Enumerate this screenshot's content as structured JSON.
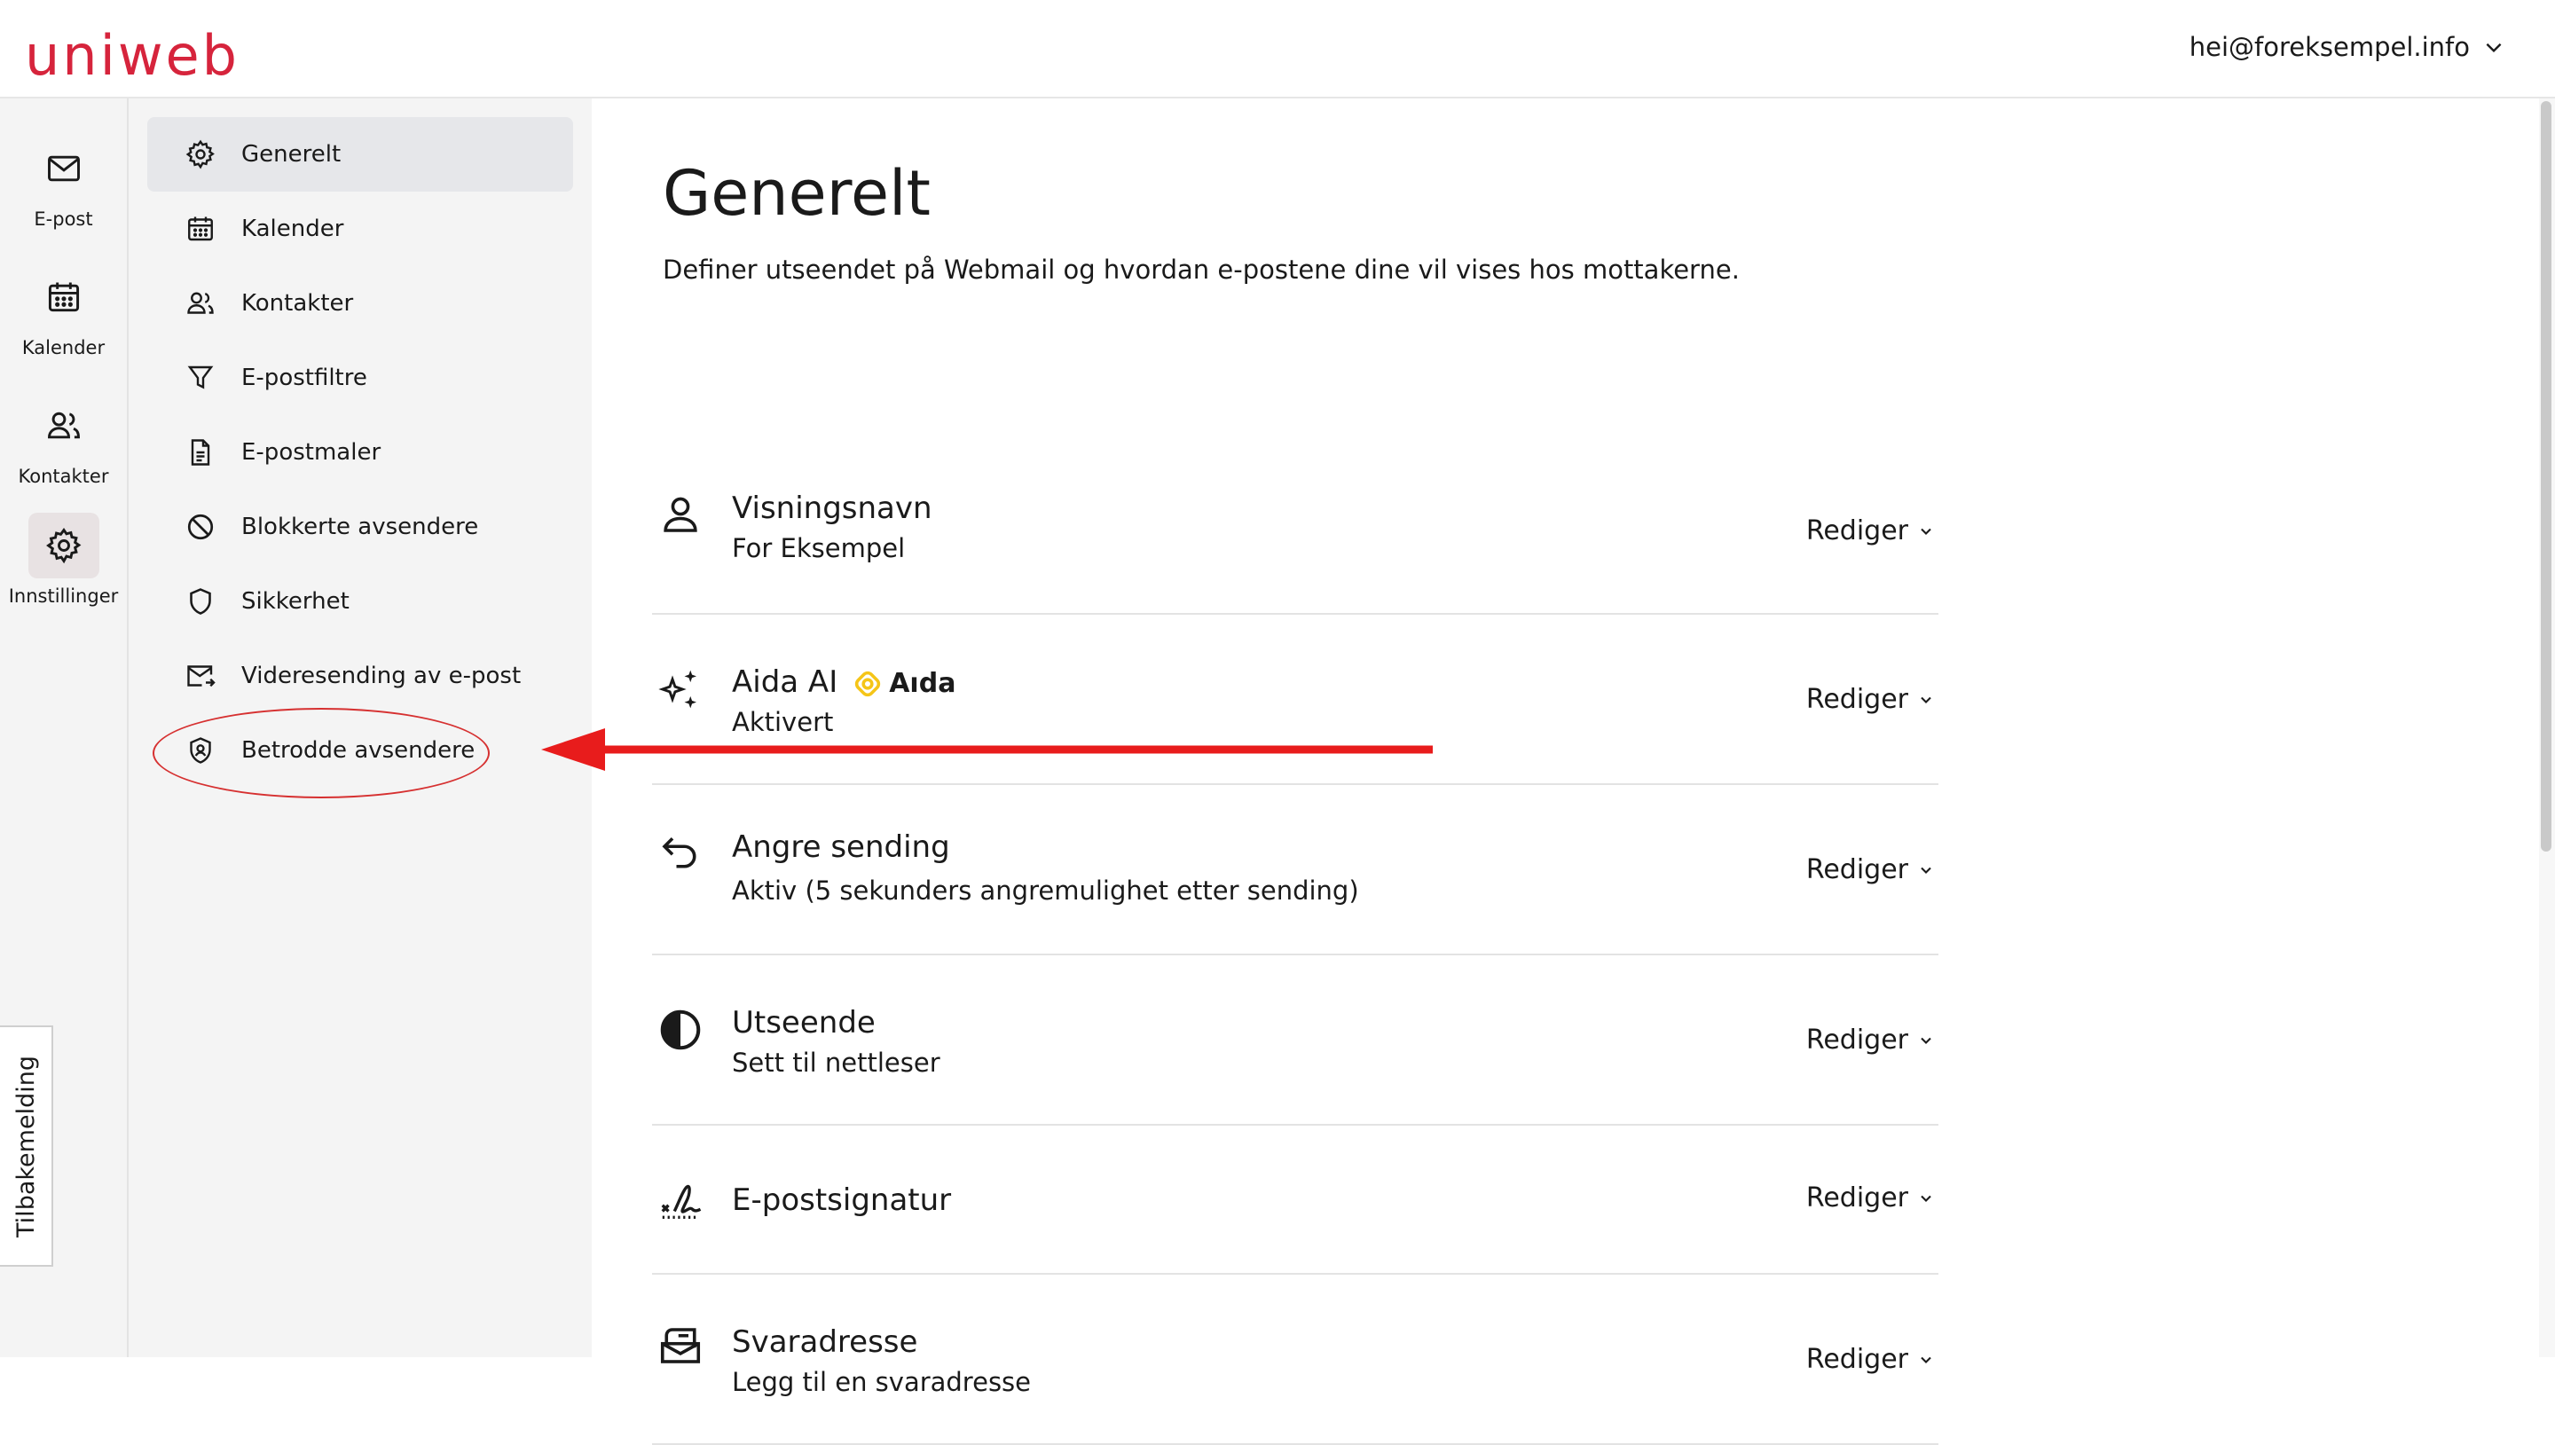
{
  "header": {
    "logo_text": "uniweb",
    "account_email": "hei@foreksempel.info"
  },
  "rail": {
    "items": [
      {
        "label": "E-post",
        "icon": "mail-icon"
      },
      {
        "label": "Kalender",
        "icon": "calendar-icon"
      },
      {
        "label": "Kontakter",
        "icon": "contacts-icon"
      },
      {
        "label": "Innstillinger",
        "icon": "gear-icon",
        "active": true
      }
    ],
    "feedback_label": "Tilbakemelding"
  },
  "submenu": {
    "items": [
      {
        "label": "Generelt",
        "icon": "gear-icon",
        "active": true
      },
      {
        "label": "Kalender",
        "icon": "calendar-icon"
      },
      {
        "label": "Kontakter",
        "icon": "contacts-icon"
      },
      {
        "label": "E-postfiltre",
        "icon": "filter-icon"
      },
      {
        "label": "E-postmaler",
        "icon": "document-icon"
      },
      {
        "label": "Blokkerte avsendere",
        "icon": "block-icon"
      },
      {
        "label": "Sikkerhet",
        "icon": "shield-icon"
      },
      {
        "label": "Videresending av e-post",
        "icon": "forward-mail-icon"
      },
      {
        "label": "Betrodde avsendere",
        "icon": "trusted-shield-icon",
        "highlighted": true
      }
    ]
  },
  "main": {
    "title": "Generelt",
    "subtitle": "Definer utseendet på Webmail og hvordan e-postene dine vil vises hos mottakerne.",
    "edit_label": "Rediger",
    "sections": [
      {
        "title": "Visningsnavn",
        "value": "For Eksempel",
        "icon": "person-icon"
      },
      {
        "title": "Aida AI",
        "badge": "Aıda",
        "value": "Aktivert",
        "icon": "sparkles-icon"
      },
      {
        "title": "Angre sending",
        "value": "Aktiv (5 sekunders angremulighet etter sending)",
        "icon": "undo-icon"
      },
      {
        "title": "Utseende",
        "value": "Sett til nettleser",
        "icon": "contrast-icon"
      },
      {
        "title": "E-postsignatur",
        "value": "",
        "icon": "signature-icon"
      },
      {
        "title": "Svaradresse",
        "value": "Legg til en svaradresse",
        "icon": "mailbox-icon"
      }
    ]
  },
  "colors": {
    "brand": "#d6243c",
    "annotation": "#e81c1c",
    "badge": "#f5c518"
  }
}
